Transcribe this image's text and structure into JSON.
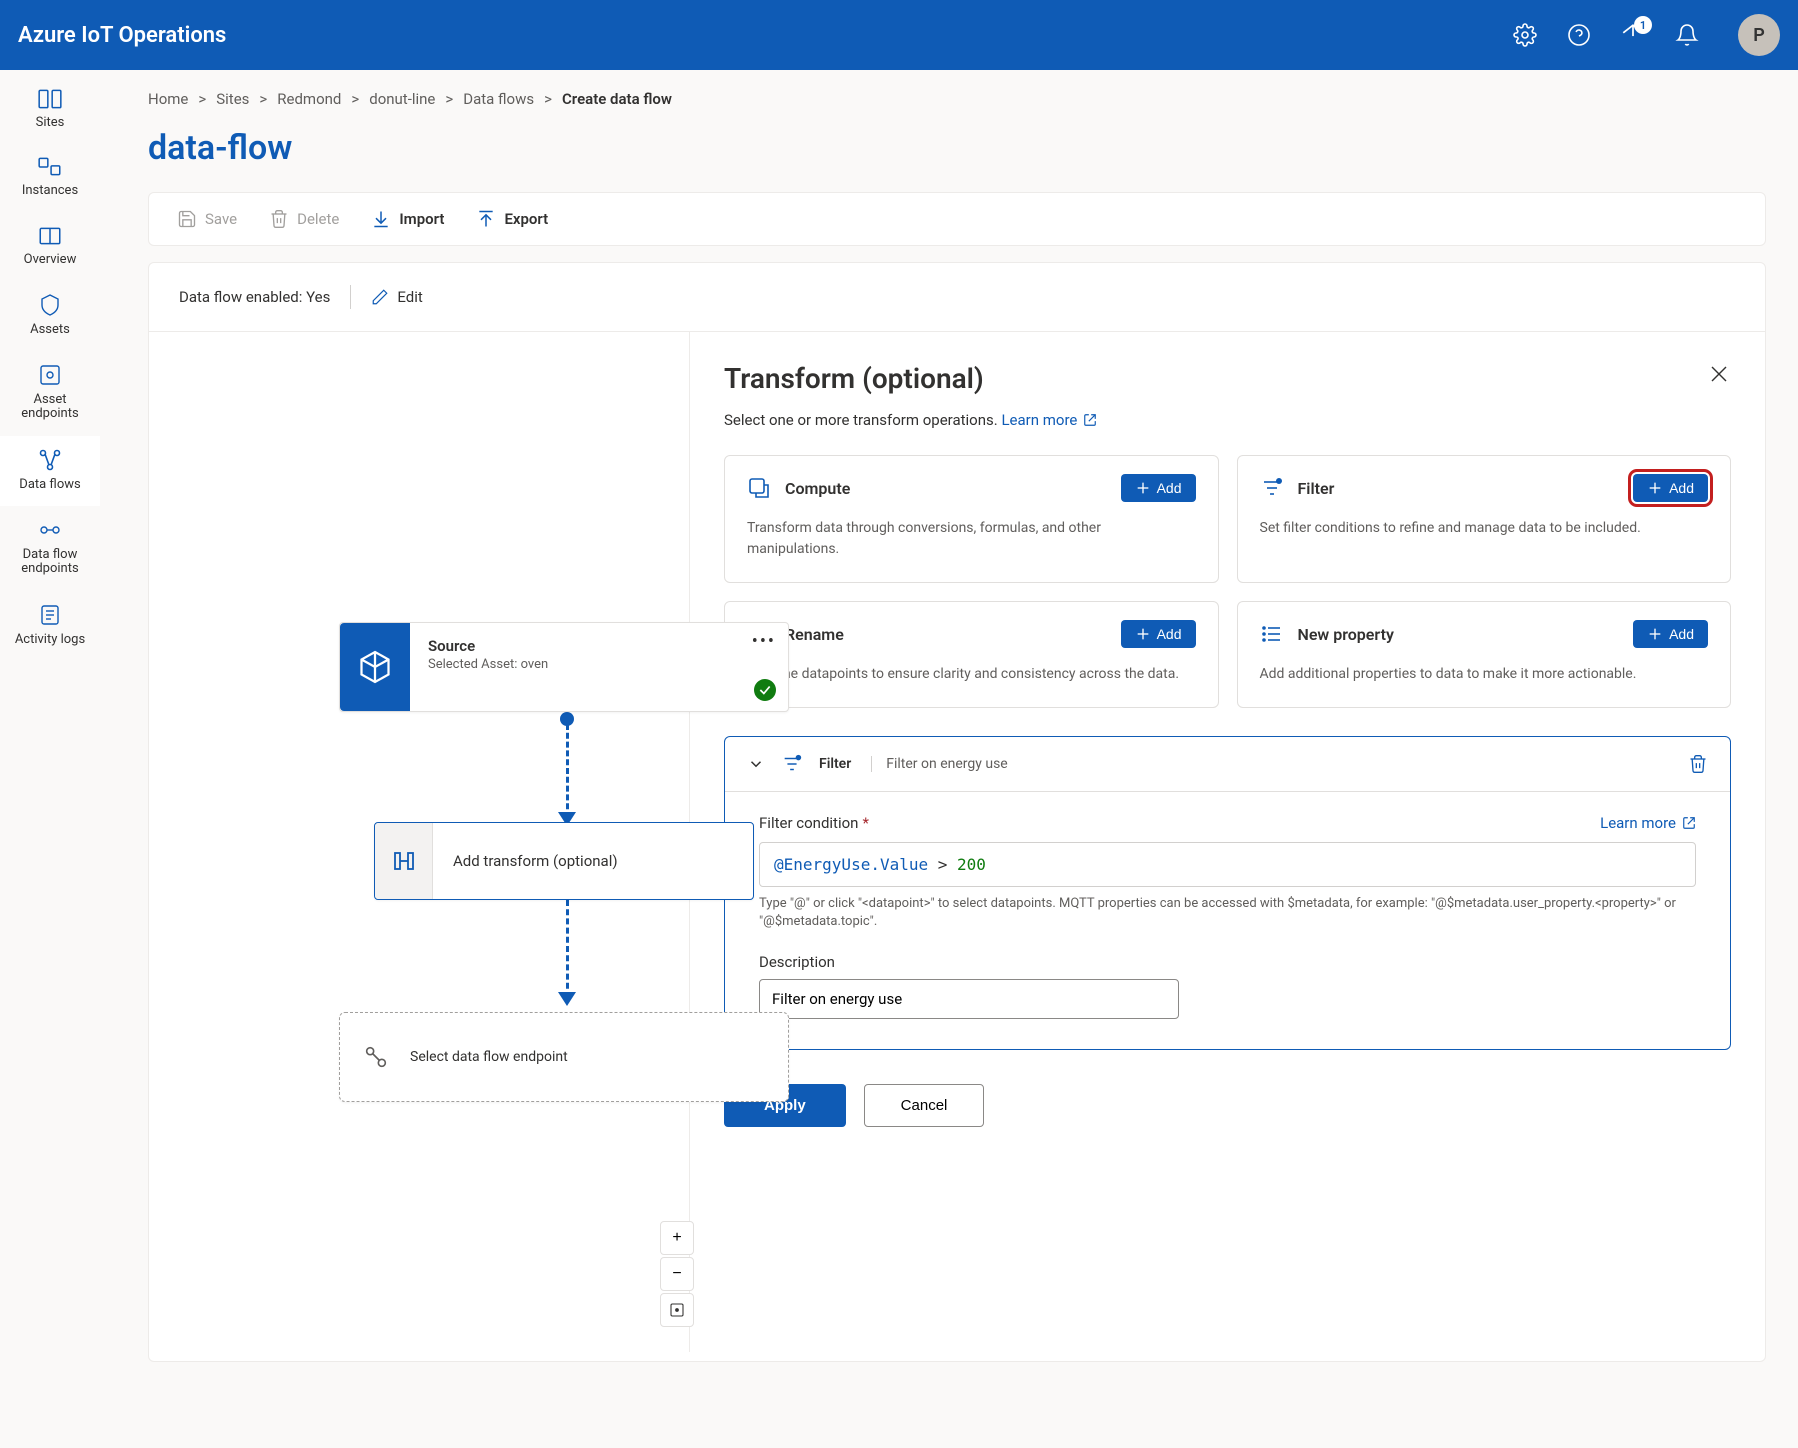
{
  "app_title": "Azure IoT Operations",
  "notification_count": "1",
  "avatar_initial": "P",
  "sidebar": [
    {
      "label": "Sites"
    },
    {
      "label": "Instances"
    },
    {
      "label": "Overview"
    },
    {
      "label": "Assets"
    },
    {
      "label": "Asset endpoints"
    },
    {
      "label": "Data flows"
    },
    {
      "label": "Data flow endpoints"
    },
    {
      "label": "Activity logs"
    }
  ],
  "crumbs": {
    "home": "Home",
    "sites": "Sites",
    "redmond": "Redmond",
    "donut": "donut-line",
    "dfs": "Data flows",
    "current": "Create data flow"
  },
  "page_title": "data-flow",
  "toolbar": {
    "save": "Save",
    "delete": "Delete",
    "import": "Import",
    "export": "Export"
  },
  "enabled_row": {
    "label": "Data flow enabled:",
    "value": "Yes",
    "edit": "Edit"
  },
  "canvas": {
    "source_title": "Source",
    "source_sub": "Selected Asset: oven",
    "transform_label": "Add transform (optional)",
    "endpoint_label": "Select data flow endpoint"
  },
  "panel": {
    "title": "Transform (optional)",
    "subtitle": "Select one or more transform operations. ",
    "learn_more": "Learn more",
    "cards": {
      "compute": {
        "title": "Compute",
        "desc": "Transform data through conversions, formulas, and other manipulations.",
        "add": "Add"
      },
      "filter": {
        "title": "Filter",
        "desc": "Set filter conditions to refine and manage data to be included.",
        "add": "Add"
      },
      "rename": {
        "title": "Rename",
        "desc": "Rename datapoints to ensure clarity and consistency across the data.",
        "add": "Add"
      },
      "newprop": {
        "title": "New property",
        "desc": "Add additional properties to data to make it more actionable.",
        "add": "Add"
      }
    },
    "filter": {
      "heading": "Filter",
      "subheading": "Filter on energy use",
      "cond_label": "Filter condition",
      "learn": "Learn more",
      "cond_at": "@EnergyUse.Value",
      "cond_op": " > ",
      "cond_num": "200",
      "hint": "Type \"@\" or click \"<datapoint>\" to select datapoints. MQTT properties can be accessed with $metadata, for example: \"@$metadata.user_property.<property>\" or \"@$metadata.topic\".",
      "desc_label": "Description",
      "desc_value": "Filter on energy use"
    },
    "apply": "Apply",
    "cancel": "Cancel"
  }
}
